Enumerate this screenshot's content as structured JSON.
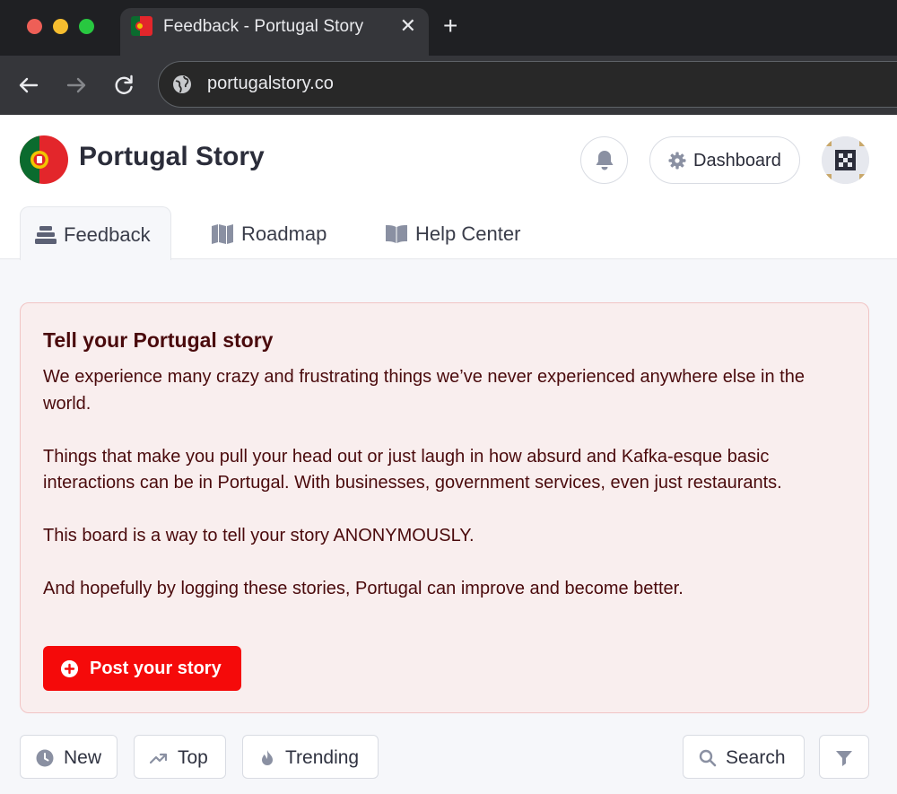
{
  "browser": {
    "tab_title": "Feedback - Portugal Story",
    "close_glyph": "✕",
    "new_tab_glyph": "+",
    "url": "portugalstory.co"
  },
  "site": {
    "brand": "Portugal Story",
    "dashboard_label": "Dashboard",
    "nav_tabs": [
      {
        "label": "Feedback",
        "icon": "tray-stack-icon",
        "active": true
      },
      {
        "label": "Roadmap",
        "icon": "map-icon",
        "active": false
      },
      {
        "label": "Help Center",
        "icon": "book-icon",
        "active": false
      }
    ]
  },
  "board": {
    "title": "Tell your Portugal story",
    "paragraphs": [
      "We experience many crazy and frustrating things we’ve never experienced anywhere else in the world.",
      "Things that make you pull your head out or just laugh in how absurd and Kafka-esque basic interactions can be in Portugal. With businesses, government services, even just restaurants.",
      "This board is a way to tell your story ANONYMOUSLY.",
      "And hopefully by logging these stories, Portugal can improve and become better."
    ],
    "post_label": "Post your story"
  },
  "filters": {
    "new": "New",
    "top": "Top",
    "trending": "Trending",
    "search": "Search"
  },
  "colors": {
    "accent": "#f50a0a",
    "card_bg": "#f9eeee",
    "card_text": "#4a0a0c"
  }
}
